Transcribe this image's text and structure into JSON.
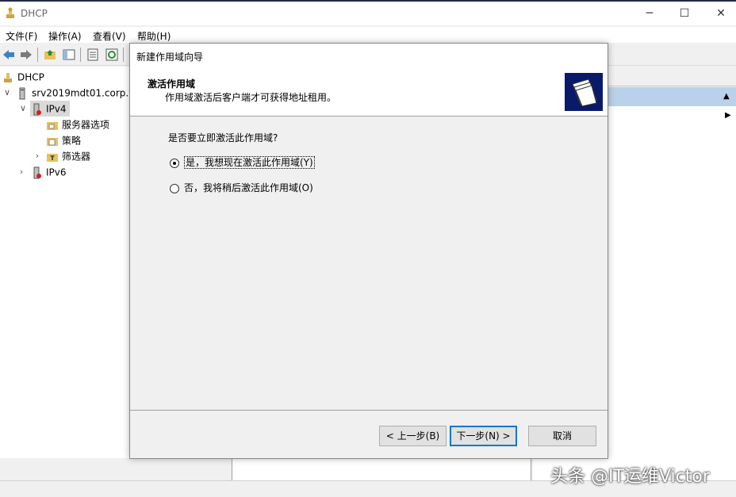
{
  "window": {
    "title": "DHCP",
    "controls": {
      "minimize": "─",
      "maximize": "☐",
      "close": "✕"
    }
  },
  "menu": [
    "文件(F)",
    "操作(A)",
    "查看(V)",
    "帮助(H)"
  ],
  "toolbar": {
    "icons": [
      "back-icon",
      "forward-icon",
      "up-folder-icon",
      "show-tree-icon",
      "properties-icon",
      "refresh-icon"
    ]
  },
  "tree": {
    "root": "DHCP",
    "server": "srv2019mdt01.corp.v",
    "ipv4": "IPv4",
    "server_options": "服务器选项",
    "policies": "策略",
    "filters": "筛选器",
    "ipv6": "IPv6"
  },
  "dialog": {
    "title": "新建作用域向导",
    "heading": "激活作用域",
    "subheading": "作用域激活后客户端才可获得地址租用。",
    "question": "是否要立即激活此作用域?",
    "options": [
      {
        "label": "是，我想现在激活此作用域(Y)",
        "selected": true
      },
      {
        "label": "否，我将稍后激活此作用域(O)",
        "selected": false
      }
    ],
    "buttons": {
      "back": "< 上一步(B)",
      "next": "下一步(N) >",
      "cancel": "取消"
    }
  },
  "watermark": "头条 @IT运维Victor",
  "colors": {
    "selection_bar": "#b9d1ea",
    "default_button_border": "#0078d7",
    "wizard_logo_bg": "#0a1a6b"
  }
}
